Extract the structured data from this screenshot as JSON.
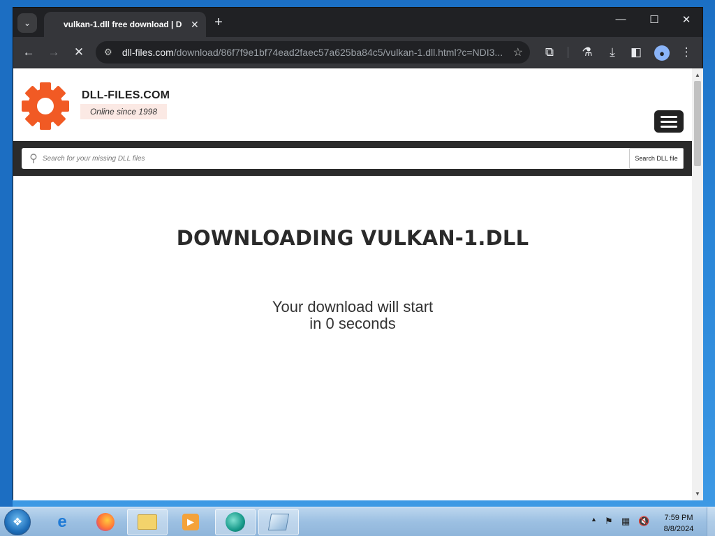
{
  "browser": {
    "tab_title": "vulkan-1.dll free download | D",
    "new_tab_symbol": "+",
    "tab_close_symbol": "✕",
    "tab_search_symbol": "⌄",
    "minimize_symbol": "—",
    "maximize_symbol": "☐",
    "close_symbol": "✕",
    "url_domain": "dll-files.com",
    "url_path": "/download/86f7f9e1bf74ead2faec57a625ba84c5/vulkan-1.dll.html?c=NDI3...",
    "loading": true
  },
  "site": {
    "brand_name": "DLL-FILES.COM",
    "tagline": "Online since 1998",
    "brand_color": "#f15a24",
    "search_placeholder": "Search for your missing DLL files",
    "search_button_label": "Search DLL file"
  },
  "main": {
    "title": "DOWNLOADING VULKAN-1.DLL",
    "countdown_line1": "Your download will start",
    "countdown_line2": "in 0 seconds"
  },
  "taskbar": {
    "time": "7:59 PM",
    "date": "8/8/2024",
    "apps": [
      {
        "name": "internet-explorer",
        "icon": "ie-icon"
      },
      {
        "name": "firefox",
        "icon": "firefox-icon"
      },
      {
        "name": "file-explorer",
        "icon": "folder-icon"
      },
      {
        "name": "media-player",
        "icon": "media-player-icon"
      },
      {
        "name": "chrome-browser",
        "icon": "browser-app-icon"
      },
      {
        "name": "app",
        "icon": "app-icon"
      }
    ]
  }
}
